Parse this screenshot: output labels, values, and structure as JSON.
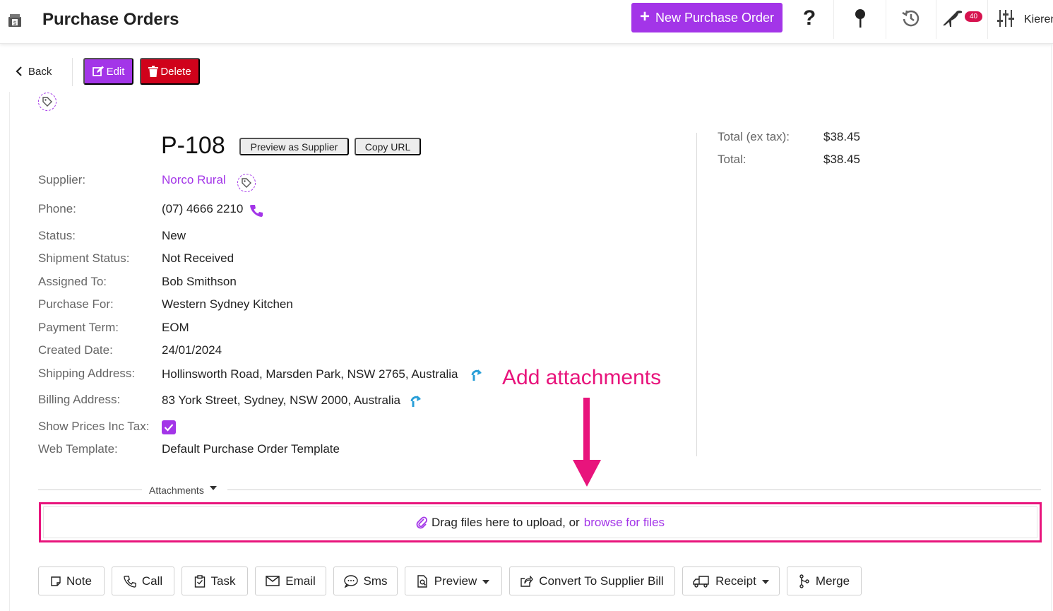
{
  "header": {
    "title": "Purchase Orders",
    "new_button": "New Purchase Order",
    "new_button_plus": "+",
    "help_icon_glyph": "?",
    "notifications_count": "40",
    "user_name": "Kieren",
    "accent_color": "#a335e8"
  },
  "toolbar": {
    "back_label": "Back",
    "edit_label": "Edit",
    "delete_label": "Delete"
  },
  "po": {
    "number": "P-108",
    "preview_supplier_label": "Preview as Supplier",
    "copy_url_label": "Copy URL"
  },
  "details": {
    "supplier": {
      "label": "Supplier:",
      "value": "Norco Rural"
    },
    "phone": {
      "label": "Phone:",
      "value": "(07) 4666 2210"
    },
    "status": {
      "label": "Status:",
      "value": "New"
    },
    "shipment_status": {
      "label": "Shipment Status:",
      "value": "Not Received"
    },
    "assigned_to": {
      "label": "Assigned To:",
      "value": "Bob Smithson"
    },
    "purchase_for": {
      "label": "Purchase For:",
      "value": "Western Sydney Kitchen"
    },
    "payment_term": {
      "label": "Payment Term:",
      "value": "EOM"
    },
    "created_date": {
      "label": "Created Date:",
      "value": "24/01/2024"
    },
    "shipping_address": {
      "label": "Shipping Address:",
      "value": "Hollinsworth Road, Marsden Park, NSW 2765, Australia"
    },
    "billing_address": {
      "label": "Billing Address:",
      "value": "83 York Street, Sydney, NSW 2000, Australia"
    },
    "show_prices_inc_tax": {
      "label": "Show Prices Inc Tax:",
      "checked": true
    },
    "web_template": {
      "label": "Web Template:",
      "value": "Default Purchase Order Template"
    }
  },
  "totals": {
    "ex_tax": {
      "label": "Total (ex tax):",
      "value": "$38.45"
    },
    "total": {
      "label": "Total:",
      "value": "$38.45"
    }
  },
  "annotation": {
    "text": "Add attachments",
    "color": "#e8147c"
  },
  "attachments": {
    "title": "Attachments",
    "drop_text": "Drag files here to upload, or",
    "browse_link": "browse for files"
  },
  "actions": {
    "note": "Note",
    "call": "Call",
    "task": "Task",
    "email": "Email",
    "sms": "Sms",
    "preview": "Preview",
    "convert": "Convert To Supplier Bill",
    "receipt": "Receipt",
    "merge": "Merge"
  }
}
